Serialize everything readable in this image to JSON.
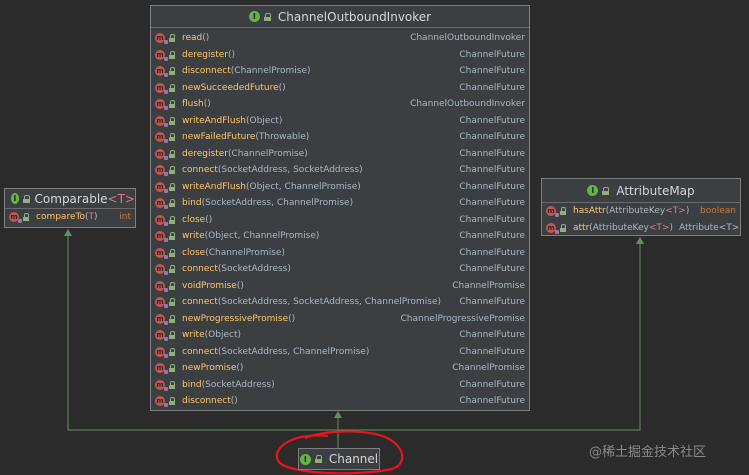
{
  "invoker": {
    "title": "ChannelOutboundInvoker",
    "methods": [
      {
        "name": "read",
        "params": "",
        "ret": "ChannelOutboundInvoker"
      },
      {
        "name": "deregister",
        "params": "",
        "ret": "ChannelFuture"
      },
      {
        "name": "disconnect",
        "params": "ChannelPromise",
        "ret": "ChannelFuture"
      },
      {
        "name": "newSucceededFuture",
        "params": "",
        "ret": "ChannelFuture"
      },
      {
        "name": "flush",
        "params": "",
        "ret": "ChannelOutboundInvoker"
      },
      {
        "name": "writeAndFlush",
        "params": "Object",
        "ret": "ChannelFuture"
      },
      {
        "name": "newFailedFuture",
        "params": "Throwable",
        "ret": "ChannelFuture"
      },
      {
        "name": "deregister",
        "params": "ChannelPromise",
        "ret": "ChannelFuture"
      },
      {
        "name": "connect",
        "params": "SocketAddress, SocketAddress",
        "ret": "ChannelFuture"
      },
      {
        "name": "writeAndFlush",
        "params": "Object, ChannelPromise",
        "ret": "ChannelFuture"
      },
      {
        "name": "bind",
        "params": "SocketAddress, ChannelPromise",
        "ret": "ChannelFuture"
      },
      {
        "name": "close",
        "params": "",
        "ret": "ChannelFuture"
      },
      {
        "name": "write",
        "params": "Object, ChannelPromise",
        "ret": "ChannelFuture"
      },
      {
        "name": "close",
        "params": "ChannelPromise",
        "ret": "ChannelFuture"
      },
      {
        "name": "connect",
        "params": "SocketAddress",
        "ret": "ChannelFuture"
      },
      {
        "name": "voidPromise",
        "params": "",
        "ret": "ChannelPromise"
      },
      {
        "name": "connect",
        "params": "SocketAddress, SocketAddress, ChannelPromise",
        "ret": "ChannelFuture"
      },
      {
        "name": "newProgressivePromise",
        "params": "",
        "ret": "ChannelProgressivePromise"
      },
      {
        "name": "write",
        "params": "Object",
        "ret": "ChannelFuture"
      },
      {
        "name": "connect",
        "params": "SocketAddress, ChannelPromise",
        "ret": "ChannelFuture"
      },
      {
        "name": "newPromise",
        "params": "",
        "ret": "ChannelPromise"
      },
      {
        "name": "bind",
        "params": "SocketAddress",
        "ret": "ChannelFuture"
      },
      {
        "name": "disconnect",
        "params": "",
        "ret": "ChannelFuture"
      }
    ]
  },
  "comparable": {
    "title": "Comparable",
    "type_param": "<T>",
    "method": {
      "name": "compareTo",
      "open": "(",
      "param": "T",
      "close": ")",
      "ret": "int"
    }
  },
  "attrmap": {
    "title": "AttributeMap",
    "methods": [
      {
        "name": "hasAttr",
        "open": "(AttributeKey",
        "tp": "<T>",
        "close": ")",
        "ret": "boolean",
        "ret_kw": true
      },
      {
        "name": "attr",
        "open": "(AttributeKey",
        "tp": "<T>",
        "close": ")",
        "ret": "Attribute<T>",
        "ret_kw": false
      }
    ]
  },
  "channel": {
    "title": "Channel"
  },
  "icons": {
    "interface": "interface-icon",
    "method": "abstract-method-icon",
    "public": "public-lock-icon"
  },
  "annotation_color": "#e8151b",
  "watermark": "@稀土掘金技术社区"
}
